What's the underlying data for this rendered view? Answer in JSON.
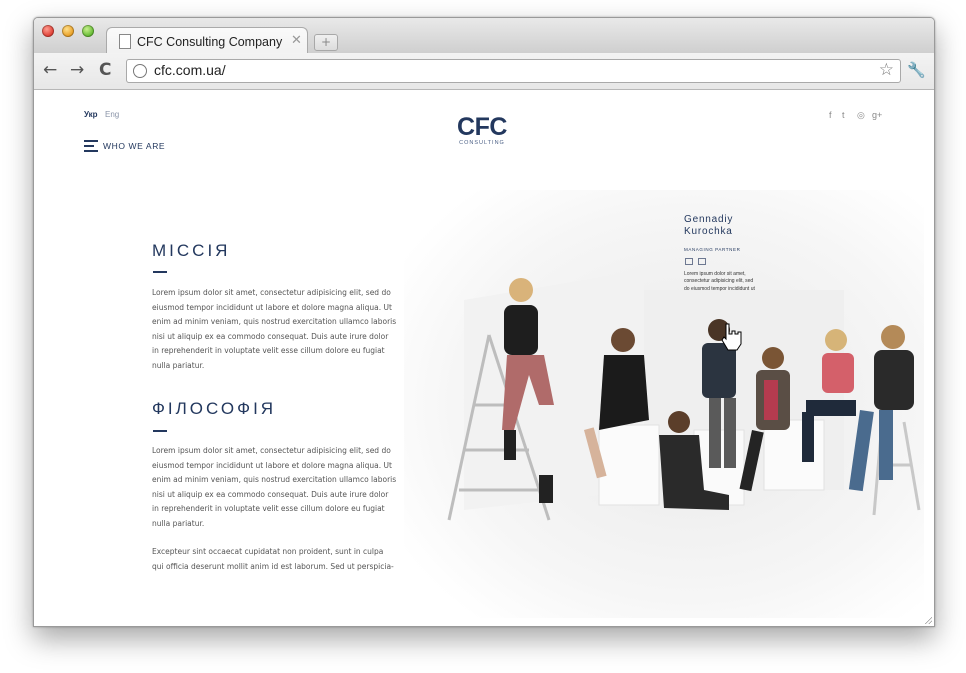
{
  "browser": {
    "tab_title": "CFC Consulting Company",
    "new_tab_label": "+",
    "url": "cfc.com.ua/",
    "back_label": "←",
    "forward_label": "→",
    "reload_label": "C"
  },
  "site": {
    "lang": {
      "ukr": "Укр",
      "eng": "Eng"
    },
    "menu_label": "WHO WE ARE",
    "logo": {
      "main": "CFC",
      "sub": "CONSULTING"
    },
    "social": {
      "facebook": "f",
      "twitter": "t",
      "instagram": "◎",
      "google": "g+"
    }
  },
  "sections": [
    {
      "heading": "МІССІЯ",
      "lines": [
        "Lorem ipsum dolor sit amet, consectetur adipisicing elit, sed do",
        "eiusmod tempor incididunt ut labore et dolore magna aliqua. Ut",
        "enim ad minim veniam, quis nostrud exercitation ullamco laboris",
        "nisi ut aliquip ex ea commodo consequat. Duis aute irure dolor",
        "in reprehenderit in voluptate velit esse cillum dolore eu fugiat",
        "nulla pariatur."
      ]
    },
    {
      "heading": "ФІЛОСОФІЯ",
      "lines": [
        "Lorem ipsum dolor sit amet, consectetur adipisicing elit, sed do",
        "eiusmod tempor incididunt ut labore et dolore magna aliqua. Ut",
        "enim ad minim veniam, quis nostrud exercitation ullamco laboris",
        "nisi ut aliquip ex ea commodo consequat. Duis aute irure dolor",
        "in reprehenderit in voluptate velit esse cillum dolore eu fugiat",
        "nulla pariatur."
      ],
      "extra_lines": [
        "Excepteur sint occaecat cupidatat non proident, sunt in culpa",
        "qui officia deserunt mollit anim id est laborum. Sed ut perspicia-"
      ]
    }
  ],
  "person": {
    "name_line1": "Gennadiy",
    "name_line2": "Kurochka",
    "role": "MANAGING PARTNER",
    "bio_lines": [
      "Lorem ipsum dolor sit amet,",
      "consectetur adipisicing elit, sed",
      "do eiusmod tempor incididunt ut"
    ]
  },
  "colors": {
    "brand": "#23385e",
    "body_text": "#555555"
  }
}
